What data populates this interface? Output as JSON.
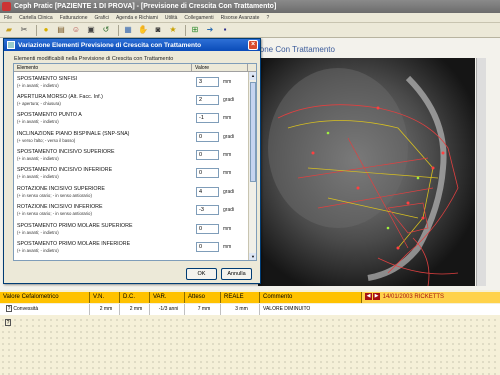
{
  "window": {
    "title": "Ceph Pratic [PAZIENTE 1 DI PROVA] - [Previsione di Crescita Con Trattamento]"
  },
  "menu": [
    "File",
    "Cartella Clinica",
    "Fatturazione",
    "Grafici",
    "Agenda e Richiami",
    "Utilità",
    "Collegamenti",
    "Risorse Avanzate",
    "?"
  ],
  "toolbar": {
    "icons": [
      "open-folder-icon",
      "cut-icon",
      "lightbulb-icon",
      "paste-icon",
      "person-icon",
      "print-icon",
      "undo-icon",
      "grid-icon",
      "hand-icon",
      "camera-icon",
      "star-icon",
      "zoom-icon",
      "arrow-icon",
      "save-icon"
    ]
  },
  "background_panel": {
    "title": "ione Con Trattamento"
  },
  "dialog": {
    "title": "Variazione Elementi Previsione di Crescita con Trattamento",
    "group_label": "Elementi modificabili nella Previsione di Crescita con Trattamento",
    "col_element": "Elemento",
    "col_value": "Valore",
    "rows": [
      {
        "name": "SPOSTAMENTO SINFISI",
        "hint": "(+ in avanti; - indietro)",
        "value": "3",
        "unit": "mm"
      },
      {
        "name": "APERTURA MORSO (Alt. Facc. Inf.)",
        "hint": "(+ apertura; - chiusura)",
        "value": "2",
        "unit": "gradi"
      },
      {
        "name": "SPOSTAMENTO PUNTO A",
        "hint": "(+ in avanti; - indietro)",
        "value": "-1",
        "unit": "mm"
      },
      {
        "name": "INCLINAZIONE PIANO BISPINALE (SNP-SNA)",
        "hint": "(+ verso l'alto; - verso il basso)",
        "value": "0",
        "unit": "gradi"
      },
      {
        "name": "SPOSTAMENTO INCISIVO SUPERIORE",
        "hint": "(+ in avanti; - indietro)",
        "value": "0",
        "unit": "mm"
      },
      {
        "name": "SPOSTAMENTO INCISIVO INFERIORE",
        "hint": "(+ in avanti; - indietro)",
        "value": "0",
        "unit": "mm"
      },
      {
        "name": "ROTAZIONE INCISIVO SUPERIORE",
        "hint": "(+ in senso orario; - in senso antiorario)",
        "value": "4",
        "unit": "gradi"
      },
      {
        "name": "ROTAZIONE INCISIVO INFERIORE",
        "hint": "(+ in senso orario; - in senso antiorario)",
        "value": "-3",
        "unit": "gradi"
      },
      {
        "name": "SPOSTAMENTO PRIMO MOLARE SUPERIORE",
        "hint": "(+ in avanti; - indietro)",
        "value": "0",
        "unit": "mm"
      },
      {
        "name": "SPOSTAMENTO PRIMO MOLARE INFERIORE",
        "hint": "(+ in avanti; - indietro)",
        "value": "0",
        "unit": "mm"
      }
    ],
    "ok_label": "OK",
    "cancel_label": "Annulla"
  },
  "bottom_table": {
    "headers": [
      "Valore Cefalometrico",
      "V.N.",
      "D.C.",
      "VAR.",
      "Atteso",
      "REALE",
      "Commento"
    ],
    "date_label": "14/01/2003 RICKETTS",
    "row": [
      "Convessità",
      "2 mm",
      "2 mm",
      "-1/3 anni",
      "7 mm",
      "3 mm",
      "VALORE DIMINUITO"
    ],
    "help_glyph": "?"
  },
  "colors": {
    "header_bg": "#ffc200",
    "title_bar": "#0a4bb8",
    "accent_red": "#a61010"
  }
}
